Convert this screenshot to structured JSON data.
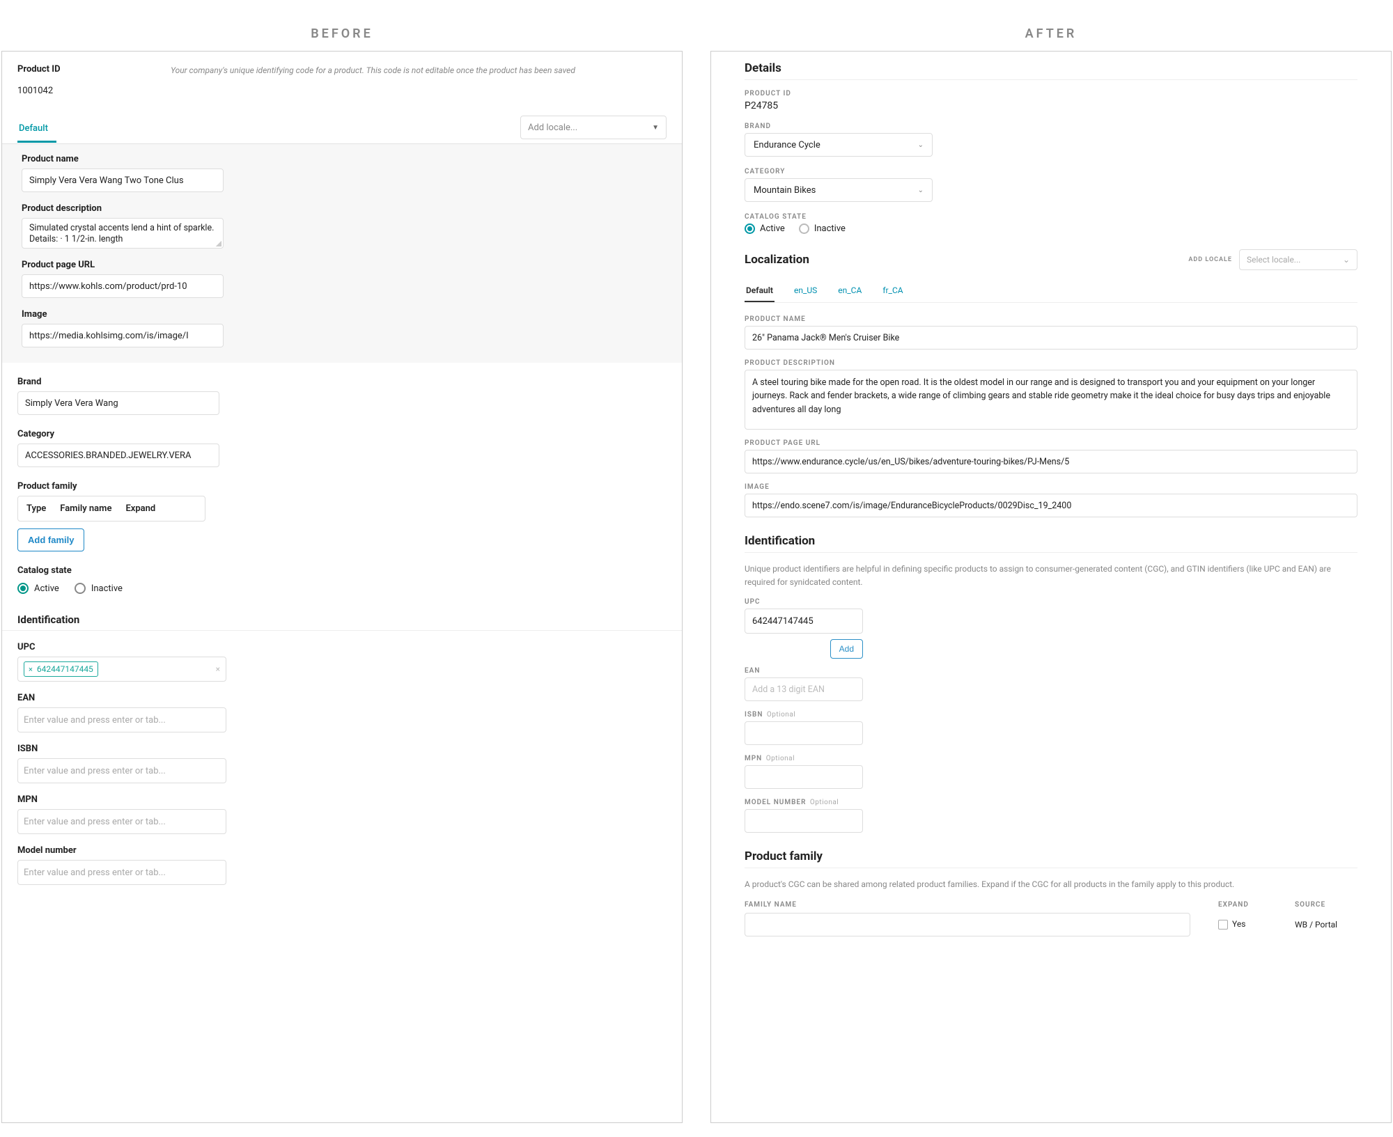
{
  "headers": {
    "before": "BEFORE",
    "after": "AFTER"
  },
  "before": {
    "product_id_label": "Product ID",
    "product_id_help": "Your company's unique identifying code for a product. This code is not editable once the product has been saved",
    "product_id_value": "1001042",
    "tab_default": "Default",
    "add_locale_placeholder": "Add locale...",
    "fields": {
      "name_label": "Product name",
      "name_value": "Simply Vera Vera Wang Two Tone Clus",
      "desc_label": "Product description",
      "desc_value": "Simulated crystal accents lend a hint of sparkle. Details: · 1 1/2-in. length",
      "url_label": "Product page URL",
      "url_value": "https://www.kohls.com/product/prd-10",
      "image_label": "Image",
      "image_value": "https://media.kohlsimg.com/is/image/I"
    },
    "brand_label": "Brand",
    "brand_value": "Simply Vera Vera Wang",
    "category_label": "Category",
    "category_value": "ACCESSORIES.BRANDED.JEWELRY.VERA",
    "family_label": "Product family",
    "family_cols": {
      "type": "Type",
      "name": "Family name",
      "expand": "Expand"
    },
    "add_family_btn": "Add family",
    "catalog_state_label": "Catalog state",
    "active_label": "Active",
    "inactive_label": "Inactive",
    "identification_header": "Identification",
    "upc_label": "UPC",
    "upc_chip": "642447147445",
    "ean_label": "EAN",
    "isbn_label": "ISBN",
    "mpn_label": "MPN",
    "model_label": "Model number",
    "enter_placeholder": "Enter value and press enter or tab..."
  },
  "after": {
    "details_header": "Details",
    "product_id_label": "Product ID",
    "product_id_value": "P24785",
    "brand_label": "Brand",
    "brand_value": "Endurance Cycle",
    "category_label": "Category",
    "category_value": "Mountain Bikes",
    "catalog_state_label": "Catalog State",
    "active_label": "Active",
    "inactive_label": "Inactive",
    "localization_header": "Localization",
    "add_locale_label": "ADD LOCALE",
    "select_locale_placeholder": "Select locale...",
    "tabs": {
      "default": "Default",
      "en_us": "en_US",
      "en_ca": "en_CA",
      "fr_ca": "fr_CA"
    },
    "name_label": "Product Name",
    "name_value": "26\" Panama Jack® Men's Cruiser Bike",
    "desc_label": "Product Description",
    "desc_value": "A steel touring bike made for the open road. It is the oldest model in our range and is designed to transport you and your equipment on your longer journeys. Rack and fender brackets, a wide range of climbing gears and stable ride geometry make it the ideal choice for busy days trips and enjoyable adventures all day long",
    "url_label": "Product Page URL",
    "url_value": "https://www.endurance.cycle/us/en_US/bikes/adventure-touring-bikes/PJ-Mens/5",
    "image_label": "Image",
    "image_value": "https://endo.scene7.com/is/image/EnduranceBicycleProducts/0029Disc_19_2400",
    "identification_header": "Identification",
    "identification_help": "Unique product identifiers are helpful in defining specific products to assign to consumer-generated content (CGC), and GTIN identifiers (like UPC and EAN) are required for synidcated content.",
    "upc_label": "UPC",
    "upc_value": "642447147445",
    "add_btn": "Add",
    "ean_label": "EAN",
    "ean_placeholder": "Add a 13 digit EAN",
    "isbn_label": "ISBN",
    "mpn_label": "MPN",
    "model_label": "Model Number",
    "optional": "Optional",
    "family_header": "Product family",
    "family_help": "A product's CGC can be shared among related product families. Expand if the CGC for all products in the family apply to this product.",
    "family_cols": {
      "name": "Family Name",
      "expand": "Expand",
      "source": "Source"
    },
    "family_expand_yes": "Yes",
    "family_source": "WB / Portal"
  }
}
